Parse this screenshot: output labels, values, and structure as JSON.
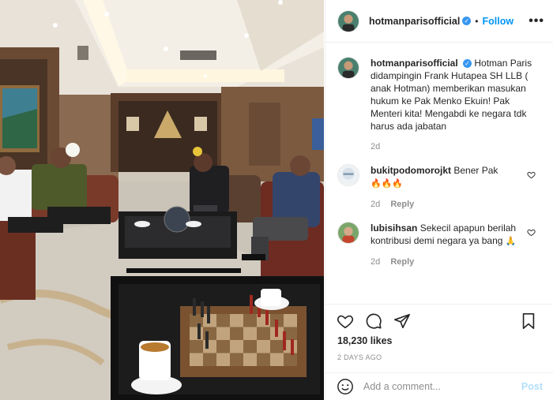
{
  "post": {
    "username": "hotmanparisofficial",
    "follow_label": "Follow",
    "separator": "•",
    "more_label": "•••",
    "verified_mark": "✓"
  },
  "caption": {
    "username": "hotmanparisofficial",
    "text": "Hotman Paris didampingin Frank Hutapea SH LLB ( anak Hotman) memberikan masukan hukum ke Pak Menko Ekuin! Pak Menteri kita! Mengabdi ke negara tdk harus ada jabatan",
    "time": "2d"
  },
  "comments": [
    {
      "username": "bukitpodomorojkt",
      "text": "Bener Pak",
      "emoji": "🔥🔥🔥",
      "time": "2d",
      "reply_label": "Reply"
    },
    {
      "username": "lubisihsan",
      "text": "Sekecil apapun berilah kontribusi demi negara ya bang",
      "emoji": "🙏",
      "time": "2d",
      "reply_label": "Reply"
    }
  ],
  "likes": "18,230 likes",
  "posted_ago": "2 DAYS AGO",
  "comment_box": {
    "placeholder": "Add a comment...",
    "post_label": "Post"
  },
  "colors": {
    "accent": "#0095f6",
    "verified": "#3897f0",
    "muted": "#8e8e8e",
    "post_disabled": "#b2dffc"
  },
  "icons": [
    "verified-icon",
    "more-icon",
    "heart-icon",
    "comment-icon",
    "share-icon",
    "bookmark-icon",
    "emoji-icon"
  ]
}
